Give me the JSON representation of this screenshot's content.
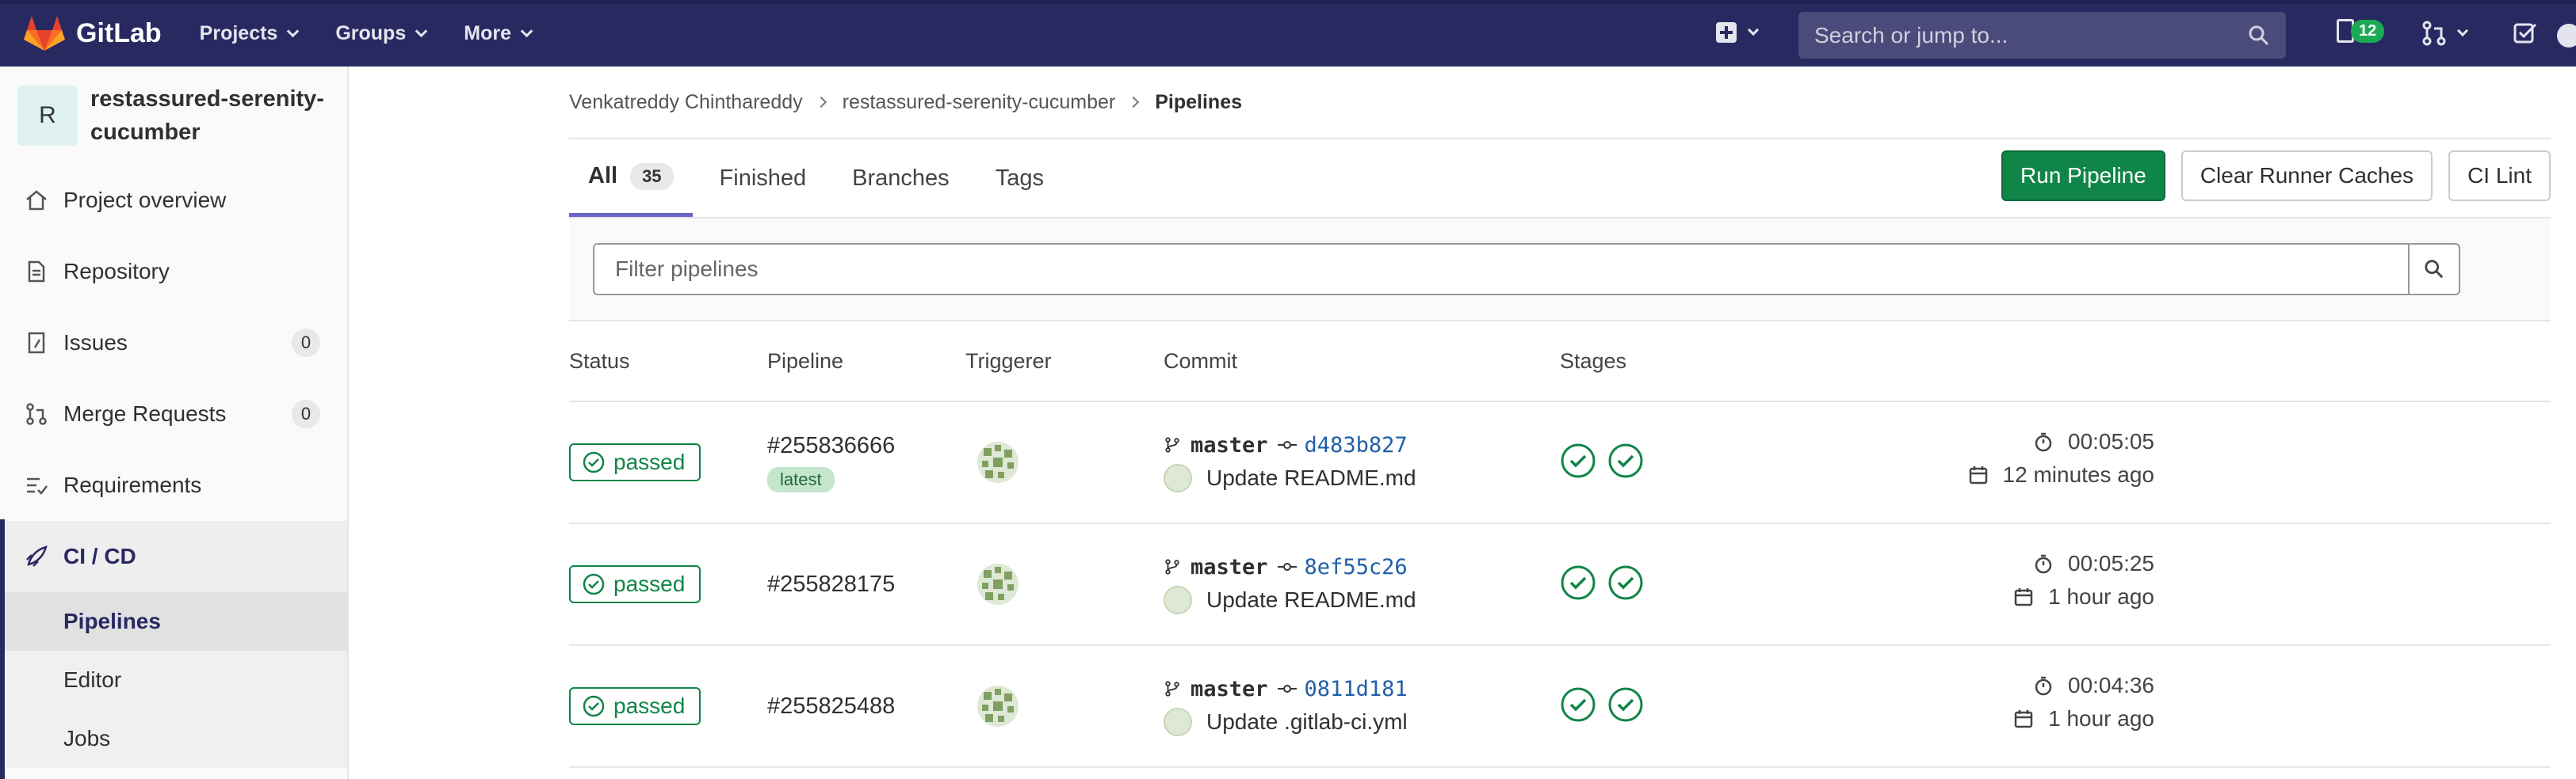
{
  "topbar": {
    "brand": "GitLab",
    "menu": [
      {
        "label": "Projects"
      },
      {
        "label": "Groups"
      },
      {
        "label": "More"
      }
    ],
    "search_placeholder": "Search or jump to...",
    "todo_count": "12"
  },
  "sidebar": {
    "project_initial": "R",
    "project_name": "restassured-serenity-cucumber",
    "items": [
      {
        "label": "Project overview",
        "icon": "home-icon"
      },
      {
        "label": "Repository",
        "icon": "doc-icon"
      },
      {
        "label": "Issues",
        "icon": "issues-icon",
        "badge": "0"
      },
      {
        "label": "Merge Requests",
        "icon": "merge-request-icon",
        "badge": "0"
      },
      {
        "label": "Requirements",
        "icon": "requirements-icon"
      },
      {
        "label": "CI / CD",
        "icon": "rocket-icon"
      }
    ],
    "ci_sub_items": [
      "Pipelines",
      "Editor",
      "Jobs"
    ]
  },
  "breadcrumb": {
    "items": [
      "Venkatreddy Chinthareddy",
      "restassured-serenity-cucumber",
      "Pipelines"
    ]
  },
  "tabs": [
    {
      "label": "All",
      "count": "35"
    },
    {
      "label": "Finished"
    },
    {
      "label": "Branches"
    },
    {
      "label": "Tags"
    }
  ],
  "buttons": {
    "run_pipeline": "Run Pipeline",
    "clear_caches": "Clear Runner Caches",
    "ci_lint": "CI Lint"
  },
  "filter": {
    "placeholder": "Filter pipelines"
  },
  "table": {
    "headers": {
      "status": "Status",
      "pipeline": "Pipeline",
      "triggerer": "Triggerer",
      "commit": "Commit",
      "stages": "Stages"
    },
    "rows": [
      {
        "status": "passed",
        "id": "#255836666",
        "tag": "latest",
        "branch": "master",
        "sha": "d483b827",
        "message": "Update README.md",
        "duration": "00:05:05",
        "finished": "12 minutes ago"
      },
      {
        "status": "passed",
        "id": "#255828175",
        "branch": "master",
        "sha": "8ef55c26",
        "message": "Update README.md",
        "duration": "00:05:25",
        "finished": "1 hour ago"
      },
      {
        "status": "passed",
        "id": "#255825488",
        "branch": "master",
        "sha": "0811d181",
        "message": "Update .gitlab-ci.yml",
        "duration": "00:04:36",
        "finished": "1 hour ago"
      }
    ]
  },
  "colors": {
    "nav_bg": "#292961",
    "success": "#108548",
    "accent": "#6666c4"
  }
}
